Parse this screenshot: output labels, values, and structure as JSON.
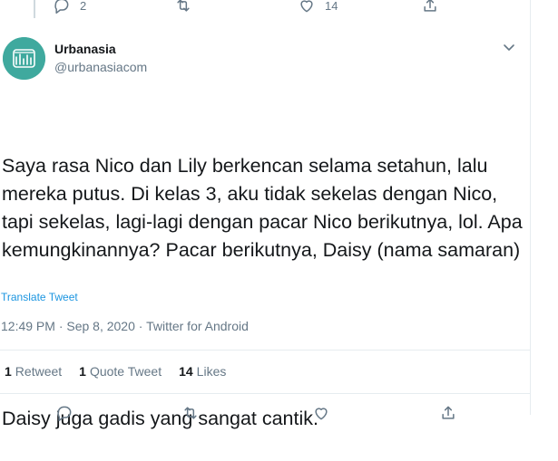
{
  "top_actions": {
    "reply_count": "2",
    "like_count": "14"
  },
  "author": {
    "name": "Urbanasia",
    "handle": "@urbanasiacom"
  },
  "tweet": {
    "paragraph1": "Saya rasa Nico dan Lily berkencan selama setahun, lalu mereka putus. Di kelas 3, aku tidak sekelas dengan Nico, tapi sekelas, lagi-lagi dengan pacar Nico berikutnya, lol. Apa kemungkinannya? Pacar berikutnya, Daisy (nama samaran)",
    "paragraph2": "Daisy juga gadis yang sangat cantik.",
    "translate_label": "Translate Tweet",
    "meta": "12:49 PM · Sep 8, 2020 · Twitter for Android"
  },
  "stats": {
    "retweets_count": "1",
    "retweets_label": "Retweet",
    "quotes_count": "1",
    "quotes_label": "Quote Tweet",
    "likes_count": "14",
    "likes_label": "Likes"
  },
  "icons": [
    "reply-icon",
    "retweet-icon",
    "like-icon",
    "share-icon",
    "more-caret-icon"
  ],
  "colors": {
    "link": "#1b95e0",
    "secondary": "#657786",
    "avatar_bg": "#3fa99e"
  }
}
